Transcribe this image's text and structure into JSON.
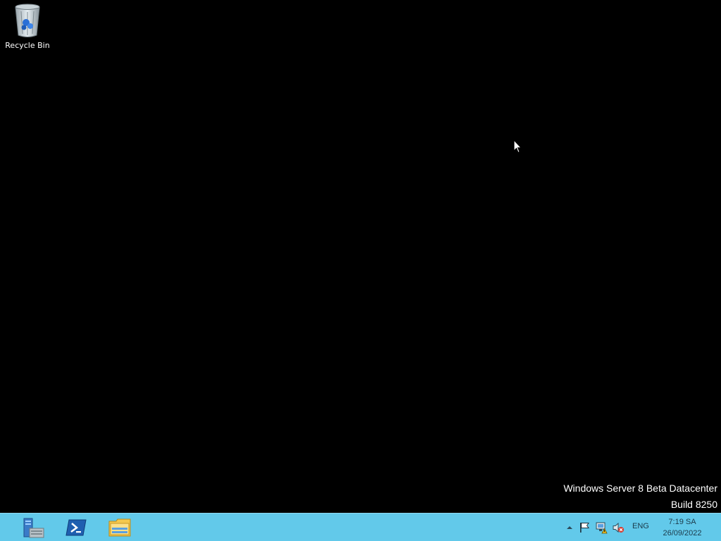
{
  "desktop": {
    "icons": [
      {
        "label": "Recycle Bin",
        "icon": "recycle-bin-icon"
      }
    ],
    "background_color": "#000000"
  },
  "watermark": {
    "line1": "Windows Server 8 Beta Datacenter",
    "line2": "Build 8250"
  },
  "taskbar": {
    "background_color": "#62c9ea",
    "pinned": [
      {
        "icon": "server-manager-icon"
      },
      {
        "icon": "powershell-icon"
      },
      {
        "icon": "file-explorer-icon"
      }
    ],
    "tray": {
      "show_hidden_icon": "chevron-up-icon",
      "icons": [
        "action-center-flag-icon",
        "network-warning-icon",
        "volume-muted-icon"
      ],
      "language": "ENG",
      "time": "7:19 SA",
      "date": "26/09/2022"
    }
  }
}
